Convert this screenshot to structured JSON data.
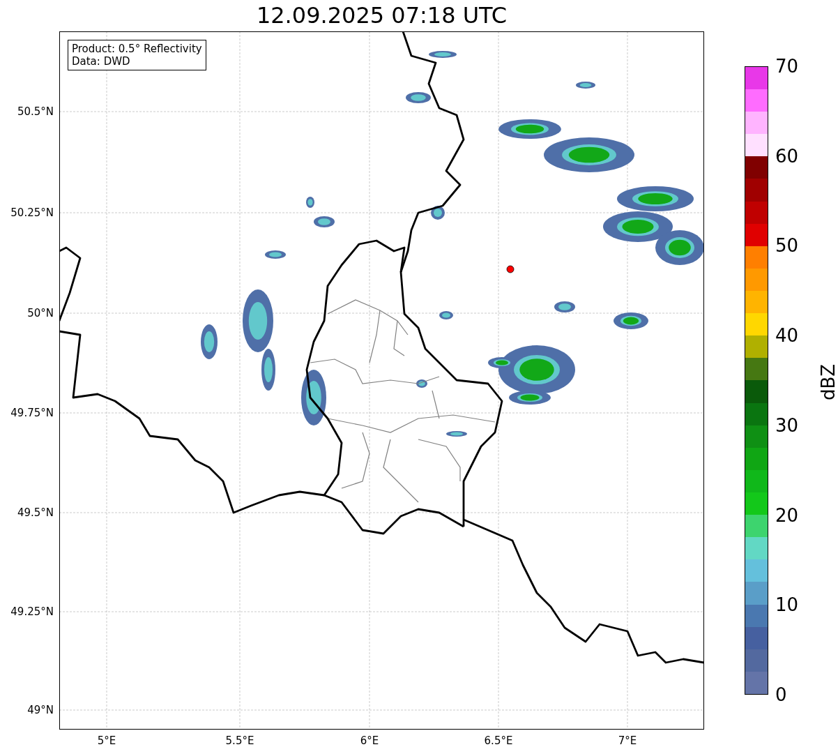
{
  "title": "12.09.2025 07:18 UTC",
  "legend": [
    "Product: 0.5° Reflectivity",
    "Data: DWD"
  ],
  "map": {
    "lat_ticks": [
      "50.5°N",
      "50.25°N",
      "50°N",
      "49.75°N",
      "49.5°N",
      "49.25°N",
      "49°N"
    ],
    "lon_ticks": [
      "5°E",
      "5.5°E",
      "6°E",
      "6.5°E",
      "7°E"
    ]
  },
  "colorbar": {
    "label": "dBZ",
    "ticks": [
      "70",
      "60",
      "50",
      "40",
      "30",
      "20",
      "10",
      "0"
    ],
    "bands": [
      {
        "color": "#6474a8"
      },
      {
        "color": "#53699f"
      },
      {
        "color": "#4660a0"
      },
      {
        "color": "#4a78b0"
      },
      {
        "color": "#5a9ec8"
      },
      {
        "color": "#64c0dc"
      },
      {
        "color": "#62d8c4"
      },
      {
        "color": "#3dd46e"
      },
      {
        "color": "#13c81a"
      },
      {
        "color": "#10b81a"
      },
      {
        "color": "#10a614"
      },
      {
        "color": "#0f9014"
      },
      {
        "color": "#0a7510"
      },
      {
        "color": "#0a5a0a"
      },
      {
        "color": "#467812"
      },
      {
        "color": "#b0b000"
      },
      {
        "color": "#ffd700"
      },
      {
        "color": "#ffb400"
      },
      {
        "color": "#ff9900"
      },
      {
        "color": "#ff7f00"
      },
      {
        "color": "#e00000"
      },
      {
        "color": "#c00000"
      },
      {
        "color": "#a00000"
      },
      {
        "color": "#800000"
      },
      {
        "color": "#ffe0ff"
      },
      {
        "color": "#ffb4ff"
      },
      {
        "color": "#ff6cff"
      },
      {
        "color": "#e838e8"
      }
    ]
  }
}
